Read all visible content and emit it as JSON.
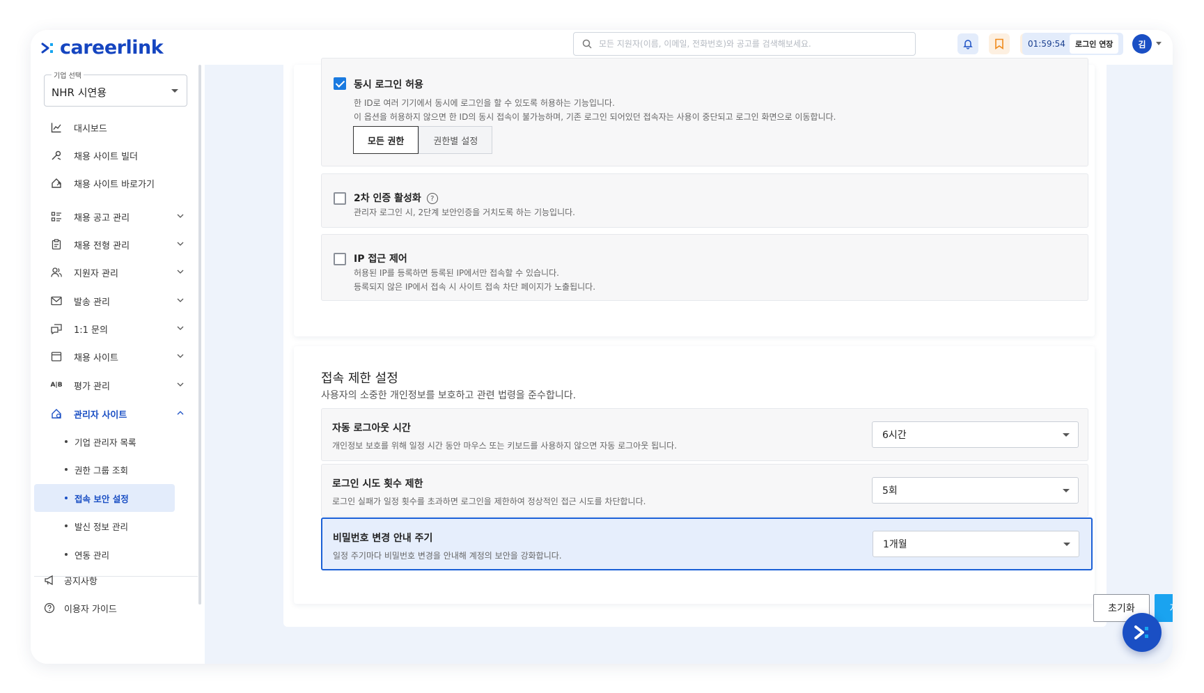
{
  "header": {
    "logo_text": "careerlink",
    "search_placeholder": "모든 지원자(이름, 이메일, 전화번호)와 공고를 검색해보세요.",
    "session_time": "01:59:54",
    "extend_label": "로그인 연장",
    "avatar_initial": "김"
  },
  "sidebar": {
    "company_label": "기업 선택",
    "company_value": "NHR 시연용",
    "items": [
      {
        "label": "대시보드",
        "icon": "chart-icon"
      },
      {
        "label": "채용 사이트 빌더",
        "icon": "tools-icon"
      },
      {
        "label": "채용 사이트 바로가기",
        "icon": "home-link-icon"
      },
      {
        "label": "채용 공고 관리",
        "icon": "list-icon"
      },
      {
        "label": "채용 전형 관리",
        "icon": "clipboard-icon"
      },
      {
        "label": "지원자 관리",
        "icon": "users-icon"
      },
      {
        "label": "발송 관리",
        "icon": "mail-icon"
      },
      {
        "label": "1:1 문의",
        "icon": "chat-icon"
      },
      {
        "label": "채용 사이트",
        "icon": "window-icon"
      },
      {
        "label": "평가 관리",
        "icon": "ab-icon"
      },
      {
        "label": "관리자 사이트",
        "icon": "admin-home-icon"
      }
    ],
    "ab_icon_text": "A|B",
    "sub_items": [
      {
        "label": "기업 관리자 목록"
      },
      {
        "label": "권한 그룹 조회"
      },
      {
        "label": "접속 보안 설정"
      },
      {
        "label": "발신 정보 관리"
      },
      {
        "label": "연동 관리"
      }
    ],
    "bottom_items": [
      {
        "label": "공지사항",
        "icon": "megaphone-icon"
      },
      {
        "label": "이용자 가이드",
        "icon": "help-icon"
      }
    ]
  },
  "security_options": {
    "concurrent": {
      "checked": true,
      "title": "동시 로그인 허용",
      "desc1": "한 ID로 여러 기기에서 동시에 로그인을 할 수 있도록 허용하는 기능입니다.",
      "desc2": "이 옵션을 허용하지 않으면 한 ID의 동시 접속이 불가능하며, 기존 로그인 되어있던 접속자는 사용이 중단되고 로그인 화면으로 이동합니다.",
      "seg_all": "모든 권한",
      "seg_role": "권한별 설정"
    },
    "two_factor": {
      "checked": false,
      "title": "2차 인증 활성화",
      "help": "?",
      "desc1": "관리자 로그인 시, 2단계 보안인증을 거치도록 하는 기능입니다."
    },
    "ip_control": {
      "checked": false,
      "title": "IP 접근 제어",
      "desc1": "허용된 IP를 등록하면 등록된 IP에서만 접속할 수 있습니다.",
      "desc2": "등록되지 않은 IP에서 접속 시 사이트 접속 차단 페이지가 노출됩니다."
    }
  },
  "access_limit": {
    "title": "접속 제한 설정",
    "desc": "사용자의 소중한 개인정보를 보호하고 관련 법령을 준수합니다.",
    "rows": [
      {
        "title": "자동 로그아웃 시간",
        "desc": "개인정보 보호를 위해 일정 시간 동안 마우스 또는 키보드를 사용하지 않으면 자동 로그아웃 됩니다.",
        "value": "6시간"
      },
      {
        "title": "로그인 시도 횟수 제한",
        "desc": "로그인 실패가 일정 횟수를 초과하면 로그인을 제한하여 정상적인 접근 시도를 차단합니다.",
        "value": "5회"
      },
      {
        "title": "비밀번호 변경 안내 주기",
        "desc": "일정 주기마다 비밀번호 변경을 안내해 계정의 보안을 강화합니다.",
        "value": "1개월"
      }
    ]
  },
  "actions": {
    "reset_label": "초기화",
    "save_label": "저장"
  },
  "colors": {
    "brand": "#1a4fc4",
    "save": "#1aa3f0",
    "highlight": "#1a5fd6"
  }
}
